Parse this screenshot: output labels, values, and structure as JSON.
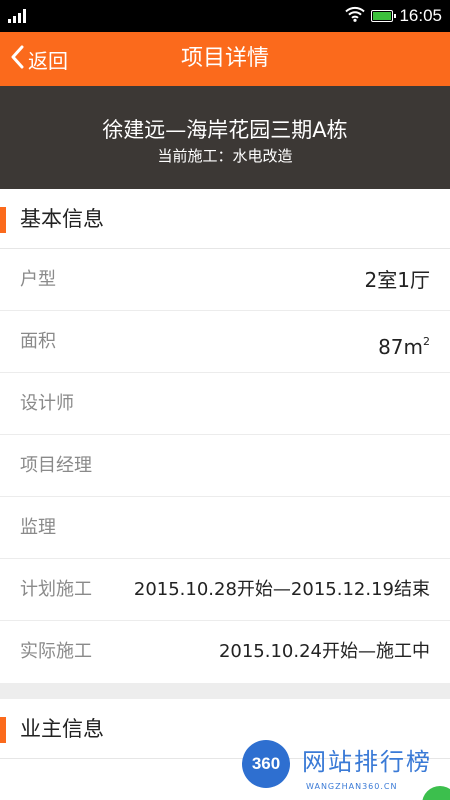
{
  "status_bar": {
    "time": "16:05",
    "battery_color": "#3cc13c"
  },
  "header": {
    "back_label": "返回",
    "title": "项目详情",
    "bg_color": "#fb6a1c"
  },
  "project": {
    "name": "徐建远—海岸花园三期A栋",
    "current_stage": "当前施工：水电改造"
  },
  "basic_info": {
    "title": "基本信息",
    "rows": [
      {
        "label": "户型",
        "value": "2室1厅"
      },
      {
        "label": "面积",
        "value": "87m",
        "unit_sup": "2"
      },
      {
        "label": "设计师",
        "value": ""
      },
      {
        "label": "项目经理",
        "value": ""
      },
      {
        "label": "监理",
        "value": ""
      },
      {
        "label": "计划施工",
        "value": "2015.10.28开始—2015.12.19结束"
      },
      {
        "label": "实际施工",
        "value": "2015.10.24开始—施工中"
      }
    ]
  },
  "owner_info": {
    "title": "业主信息"
  },
  "watermark": {
    "badge": "360",
    "name": "网站排行榜",
    "url": "WANGZHAN360.CN"
  }
}
